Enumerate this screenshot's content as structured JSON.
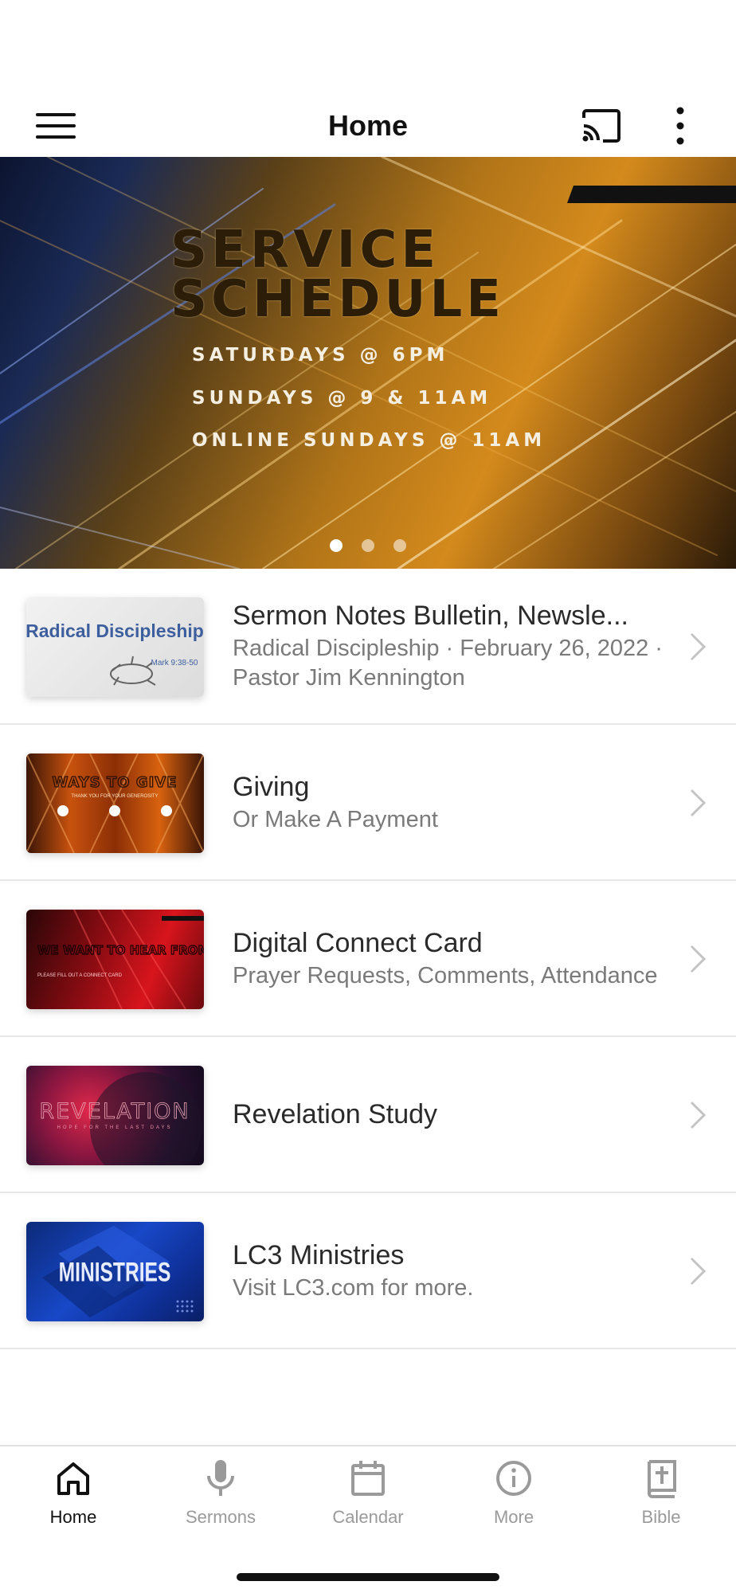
{
  "header": {
    "title": "Home",
    "menu_icon": "hamburger-menu-icon",
    "cast_icon": "cast-icon",
    "more_icon": "vertical-more-icon"
  },
  "banner": {
    "title_line1": "SERVICE",
    "title_line2": "SCHEDULE",
    "line1": "SATURDAYS @ 6PM",
    "line2": "SUNDAYS @ 9 & 11AM",
    "line3": "ONLINE SUNDAYS @ 11AM",
    "slide_count": 3,
    "active_slide": 1
  },
  "items": [
    {
      "title": "Sermon Notes Bulletin, Newsle...",
      "subtitle": "Radical Discipleship · February 26, 2022 · Pastor Jim Kennington",
      "thumb_text": "Radical Discipleship",
      "thumb_sub": "Mark 9:38-50"
    },
    {
      "title": "Giving",
      "subtitle": "Or Make A Payment",
      "thumb_text": "WAYS TO GIVE",
      "thumb_sub": "THANK YOU FOR YOUR GENEROSITY"
    },
    {
      "title": "Digital Connect Card",
      "subtitle": "Prayer Requests, Comments, Attendance",
      "thumb_text": "WE WANT TO HEAR FROM YOU!",
      "thumb_sub": "PLEASE FILL OUT A CONNECT CARD"
    },
    {
      "title": "Revelation Study",
      "subtitle": "",
      "thumb_text": "REVELATION",
      "thumb_sub": "HOPE FOR THE LAST DAYS"
    },
    {
      "title": "LC3 Ministries",
      "subtitle": "Visit LC3.com for more.",
      "thumb_text": "MINISTRIES",
      "thumb_sub": ""
    }
  ],
  "tabs": [
    {
      "label": "Home",
      "icon": "home-icon",
      "active": true
    },
    {
      "label": "Sermons",
      "icon": "microphone-icon",
      "active": false
    },
    {
      "label": "Calendar",
      "icon": "calendar-icon",
      "active": false
    },
    {
      "label": "More",
      "icon": "info-icon",
      "active": false
    },
    {
      "label": "Bible",
      "icon": "bible-icon",
      "active": false
    }
  ],
  "colors": {
    "active_tab": "#111111",
    "inactive_tab": "#9a9a9a",
    "chevron": "#c4c4c4"
  }
}
